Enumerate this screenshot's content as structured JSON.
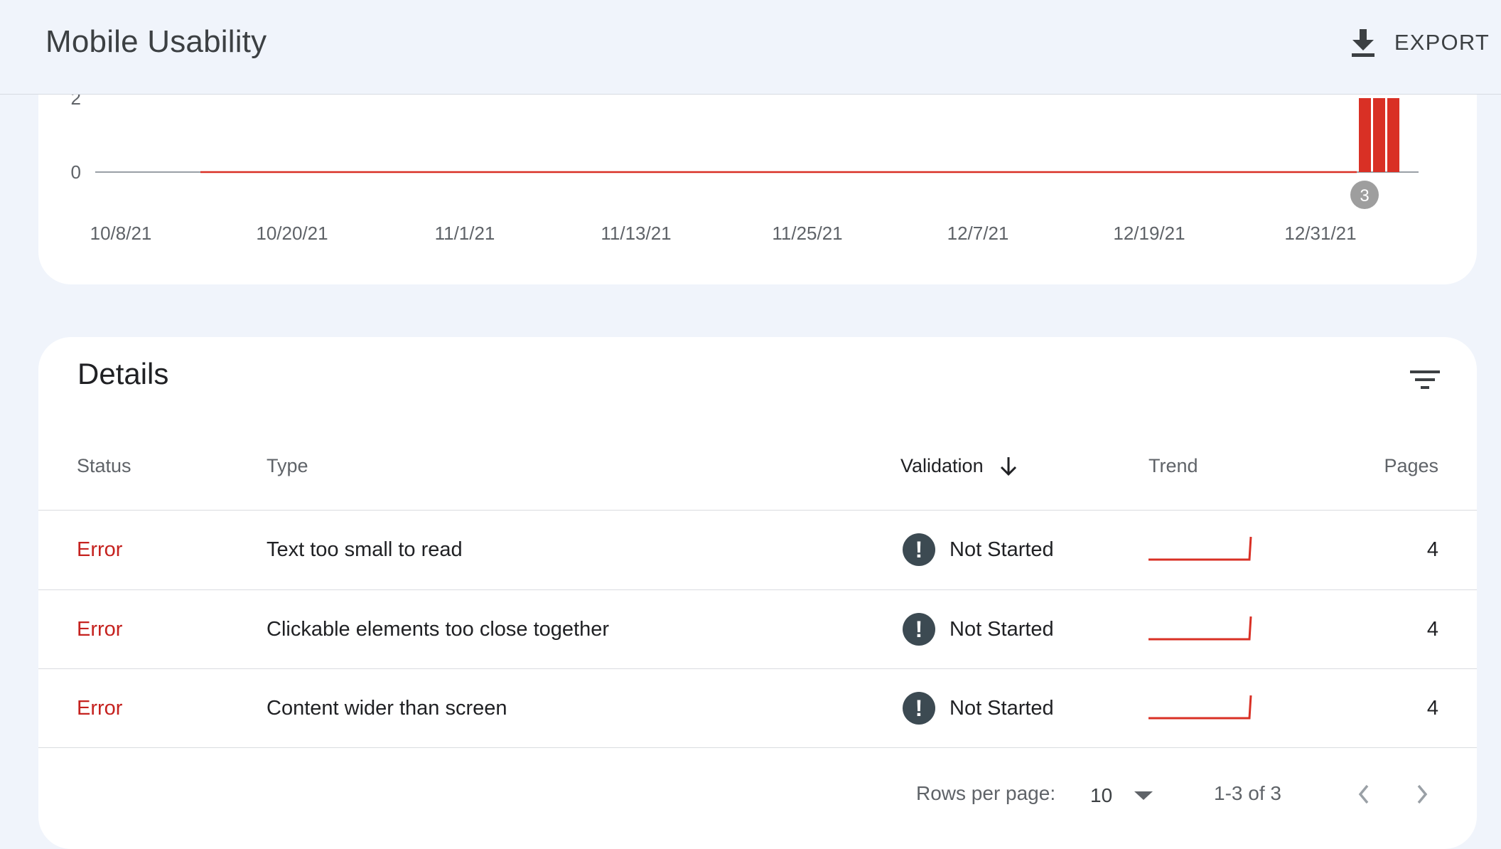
{
  "header": {
    "title": "Mobile Usability",
    "export_label": "EXPORT"
  },
  "chart_data": {
    "type": "bar",
    "y_ticks": [
      "2",
      "0"
    ],
    "x_labels": [
      "10/8/21",
      "10/20/21",
      "11/1/21",
      "11/13/21",
      "11/25/21",
      "12/7/21",
      "12/19/21",
      "12/31/21"
    ],
    "series": [
      {
        "color": "#d93025",
        "values": [
          2,
          2,
          2
        ]
      }
    ],
    "annotation": "3",
    "colors": {
      "bar": "#d93025",
      "baseline": "#9aa0a6",
      "marker": "#9e9e9e"
    }
  },
  "details": {
    "title": "Details",
    "columns": {
      "status": "Status",
      "type": "Type",
      "validation": "Validation",
      "trend": "Trend",
      "pages": "Pages"
    },
    "rows": [
      {
        "status": "Error",
        "type": "Text too small to read",
        "validation": "Not Started",
        "pages": "4"
      },
      {
        "status": "Error",
        "type": "Clickable elements too close together",
        "validation": "Not Started",
        "pages": "4"
      },
      {
        "status": "Error",
        "type": "Content wider than screen",
        "validation": "Not Started",
        "pages": "4"
      }
    ],
    "warn_glyph": "!"
  },
  "pagination": {
    "rows_per_page_label": "Rows per page:",
    "rows_per_page_value": "10",
    "range": "1-3 of 3"
  },
  "icons": {
    "export": "download-icon",
    "filter": "filter-icon",
    "sort": "arrow-down-icon",
    "status": "warning-circle-icon",
    "dropdown": "caret-down-icon",
    "prev": "chevron-left-icon",
    "next": "chevron-right-icon"
  }
}
